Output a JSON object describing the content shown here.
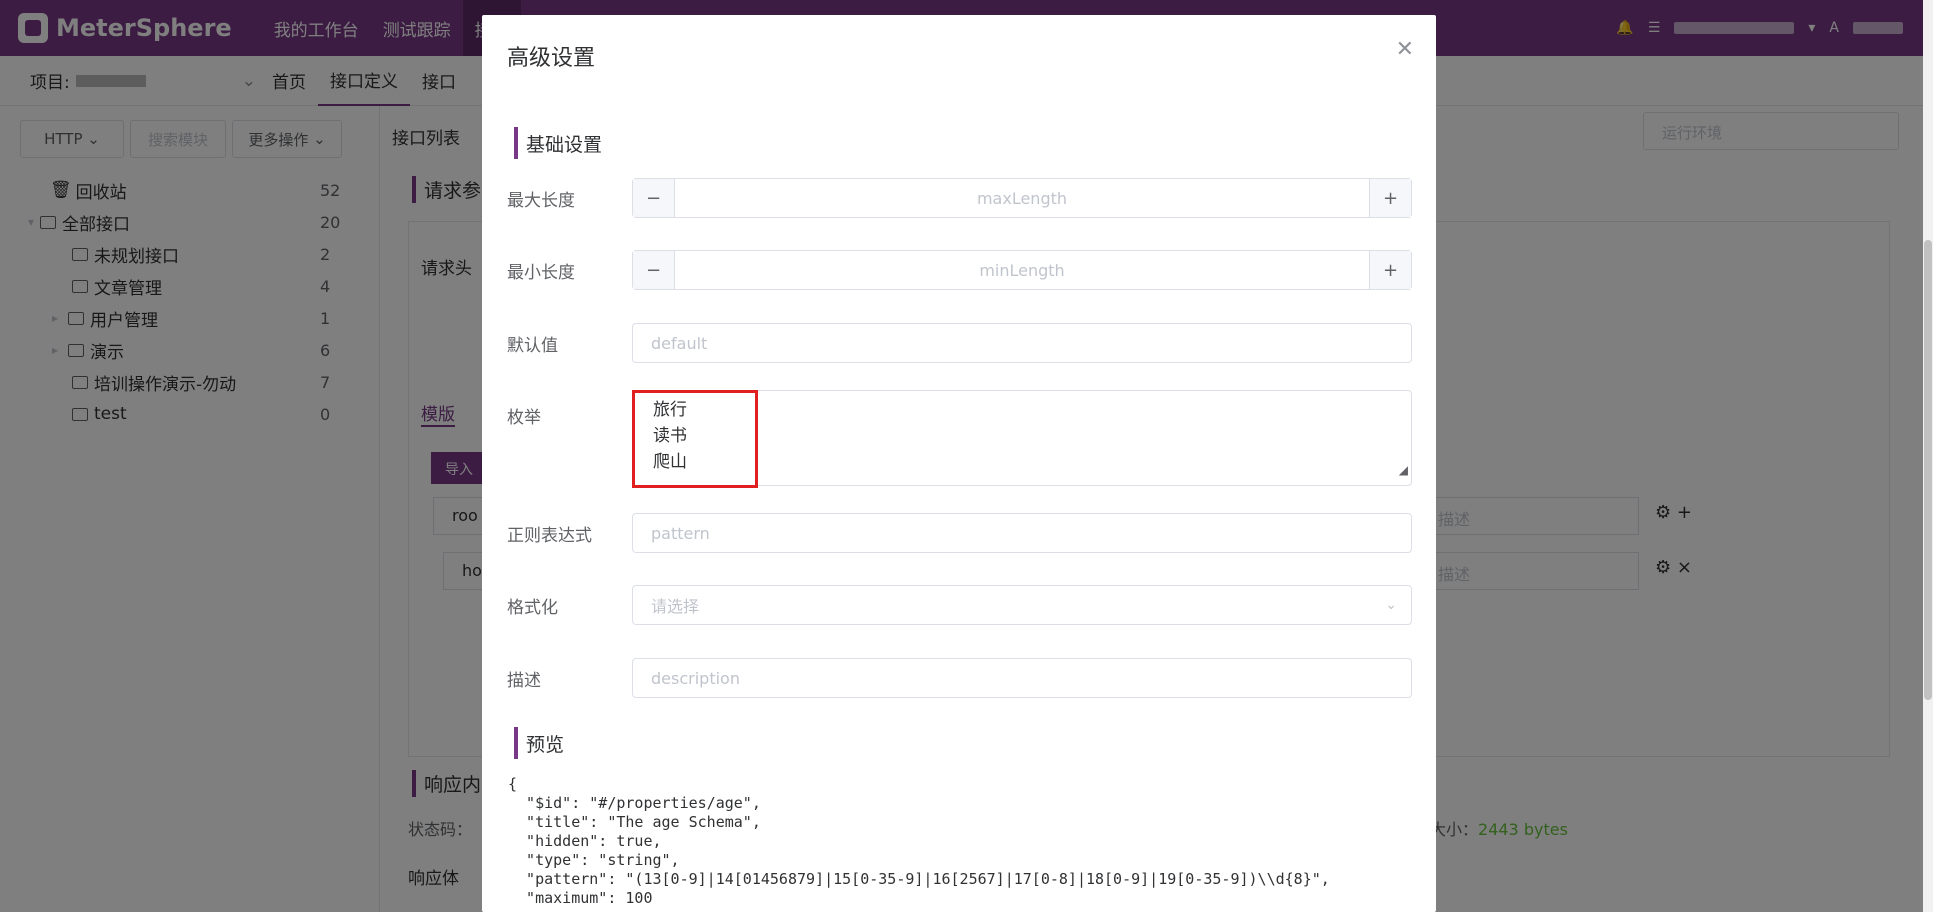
{
  "app": {
    "name": "MeterSphere"
  },
  "topnav": {
    "items": [
      "我的工作台",
      "测试跟踪",
      "接口"
    ]
  },
  "subbar": {
    "project_label": "项目:",
    "items": [
      "首页",
      "接口定义",
      "接口"
    ]
  },
  "left": {
    "protocol": "HTTP",
    "search_placeholder": "搜索模块",
    "more_ops": "更多操作",
    "tree": [
      {
        "label": "回收站",
        "count": "52"
      },
      {
        "label": "全部接口",
        "count": "20"
      },
      {
        "label": "未规划接口",
        "count": "2"
      },
      {
        "label": "文章管理",
        "count": "4"
      },
      {
        "label": "用户管理",
        "count": "1"
      },
      {
        "label": "演示",
        "count": "6"
      },
      {
        "label": "培训操作演示-勿动",
        "count": "7"
      },
      {
        "label": "test",
        "count": "0"
      }
    ]
  },
  "main": {
    "list_title": "接口列表",
    "env_placeholder": "运行环境",
    "req_title": "请求参",
    "req_header": "请求头",
    "tab_template": "模版",
    "import_btn": "导入",
    "root_field": "roo",
    "hobby_field": "ho",
    "desc_placeholder": "描述",
    "resp_title": "响应内",
    "status_label": "状态码：",
    "size_label": "大小：",
    "size_value": "2443 bytes",
    "resp_body": "响应体"
  },
  "dialog": {
    "title": "高级设置",
    "section_basic": "基础设置",
    "max_len_label": "最大长度",
    "max_len_placeholder": "maxLength",
    "min_len_label": "最小长度",
    "min_len_placeholder": "minLength",
    "default_label": "默认值",
    "default_placeholder": "default",
    "enum_label": "枚举",
    "enum_values": [
      "旅行",
      "读书",
      "爬山"
    ],
    "pattern_label": "正则表达式",
    "pattern_placeholder": "pattern",
    "format_label": "格式化",
    "format_placeholder": "请选择",
    "desc_label": "描述",
    "desc_placeholder": "description",
    "section_preview": "预览",
    "preview_text": "{\n  \"$id\": \"#/properties/age\",\n  \"title\": \"The age Schema\",\n  \"hidden\": true,\n  \"type\": \"string\",\n  \"pattern\": \"(13[0-9]|14[01456879]|15[0-35-9]|16[2567]|17[0-8]|18[0-9]|19[0-35-9])\\\\d{8}\",\n  \"maximum\": 100"
  }
}
